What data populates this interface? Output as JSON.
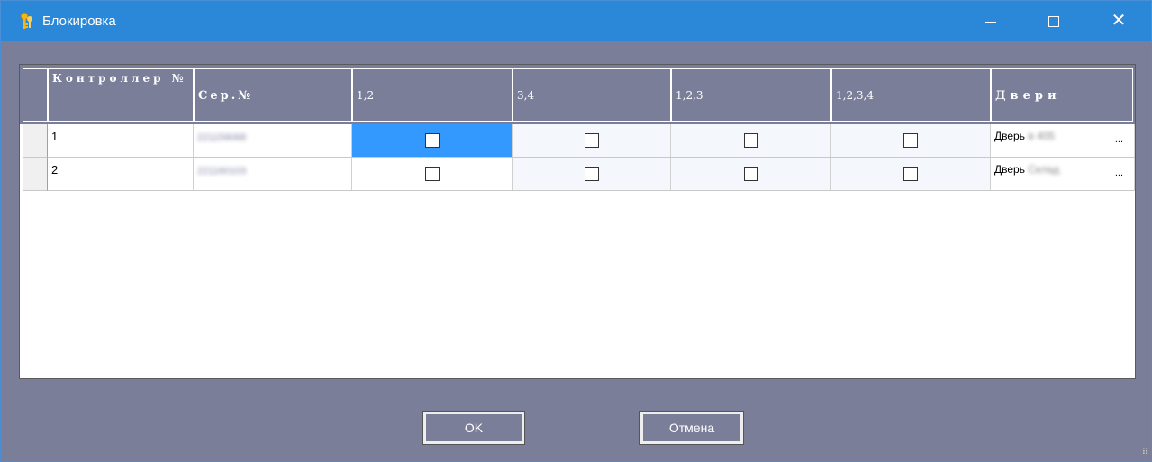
{
  "window": {
    "title": "Блокировка",
    "icon": "keys-icon"
  },
  "grid": {
    "columns": [
      "Контроллер №",
      "Сер.№",
      "1,2",
      "3,4",
      "1,2,3",
      "1,2,3,4",
      "Двери"
    ],
    "rows": [
      {
        "controller": "1",
        "serial": "221159068",
        "door_prefix": "Дверь",
        "door_blur": "в 405",
        "door_more": "..."
      },
      {
        "controller": "2",
        "serial": "221160103",
        "door_prefix": "Дверь",
        "door_blur": "Склад",
        "door_more": "..."
      }
    ]
  },
  "buttons": {
    "ok": "OK",
    "cancel": "Отмена"
  }
}
